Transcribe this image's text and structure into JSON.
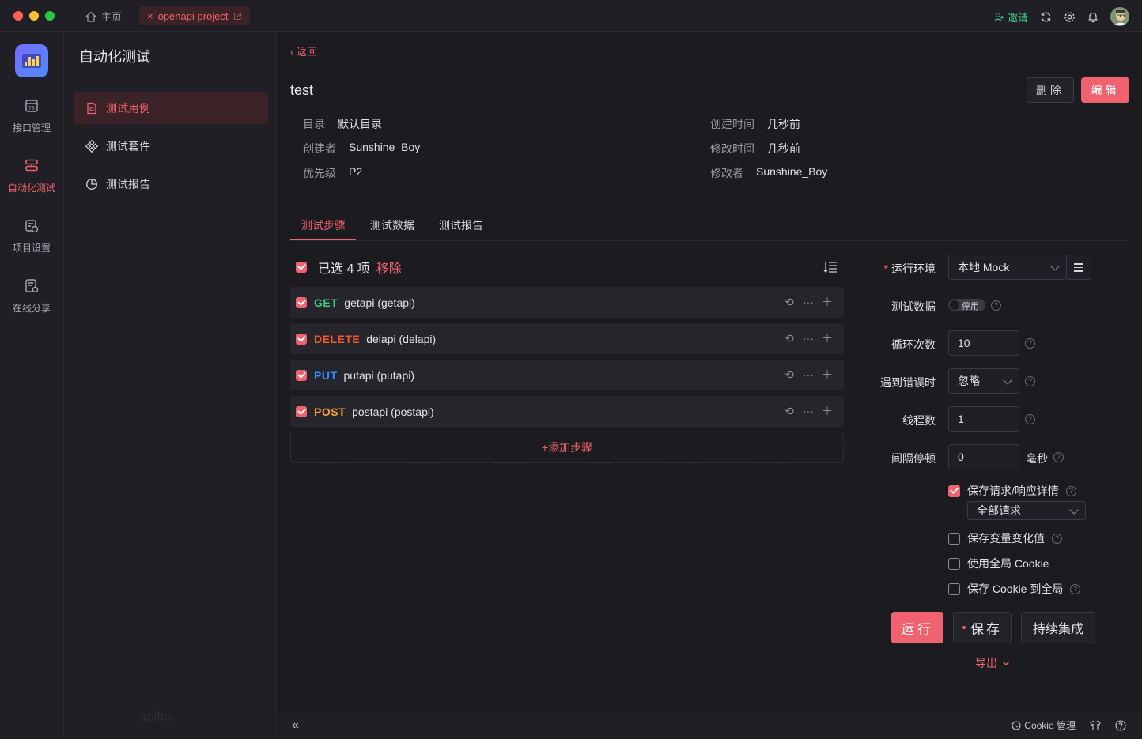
{
  "titlebar": {
    "home_label": "主页",
    "project_tab": "openapi project",
    "invite_label": "邀请"
  },
  "rail": {
    "items": [
      {
        "label": "接口管理",
        "icon": "api-icon"
      },
      {
        "label": "自动化测试",
        "icon": "automation-icon",
        "active": true
      },
      {
        "label": "项目设置",
        "icon": "project-settings-icon"
      },
      {
        "label": "在线分享",
        "icon": "share-icon"
      }
    ]
  },
  "subnav": {
    "title": "自动化测试",
    "items": [
      {
        "label": "测试用例",
        "icon": "test-case-icon",
        "active": true
      },
      {
        "label": "测试套件",
        "icon": "test-suite-icon"
      },
      {
        "label": "测试报告",
        "icon": "test-report-icon"
      }
    ],
    "watermark": "apifox"
  },
  "main": {
    "back_label": "返回",
    "title": "test",
    "delete_label": "删除",
    "edit_label": "编辑",
    "meta": {
      "dir_key": "目录",
      "dir_val": "默认目录",
      "creator_key": "创建者",
      "creator_val": "Sunshine_Boy",
      "priority_key": "优先级",
      "priority_val": "P2",
      "created_key": "创建时间",
      "created_val": "几秒前",
      "modified_key": "修改时间",
      "modified_val": "几秒前",
      "modifier_key": "修改者",
      "modifier_val": "Sunshine_Boy"
    },
    "tabs": [
      "测试步骤",
      "测试数据",
      "测试报告"
    ],
    "selection": {
      "text": "已选 4 项",
      "remove": "移除"
    },
    "steps": [
      {
        "method": "GET",
        "name": "getapi (getapi)"
      },
      {
        "method": "DELETE",
        "name": "delapi (delapi)"
      },
      {
        "method": "PUT",
        "name": "putapi (putapi)"
      },
      {
        "method": "POST",
        "name": "postapi (postapi)"
      }
    ],
    "add_step": "+添加步骤"
  },
  "run_panel": {
    "env_label": "运行环境",
    "env_value": "本地 Mock",
    "data_label": "测试数据",
    "data_toggle": "停用",
    "loop_label": "循环次数",
    "loop_value": "10",
    "error_label": "遇到错误时",
    "error_value": "忽略",
    "threads_label": "线程数",
    "threads_value": "1",
    "delay_label": "间隔停顿",
    "delay_value": "0",
    "delay_unit": "毫秒",
    "save_detail": "保存请求/响应详情",
    "save_detail_scope": "全部请求",
    "save_vars": "保存变量变化值",
    "use_cookie": "使用全局 Cookie",
    "save_cookie": "保存 Cookie 到全局",
    "run_label": "运行",
    "save_label": "保存",
    "ci_label": "持续集成",
    "export_label": "导出"
  },
  "footer": {
    "cookie_label": "Cookie 管理"
  },
  "colors": {
    "accent": "#f0636e",
    "get": "#3ec98a",
    "delete": "#ef5a2c",
    "put": "#2f8fff",
    "post": "#f4a13a"
  }
}
